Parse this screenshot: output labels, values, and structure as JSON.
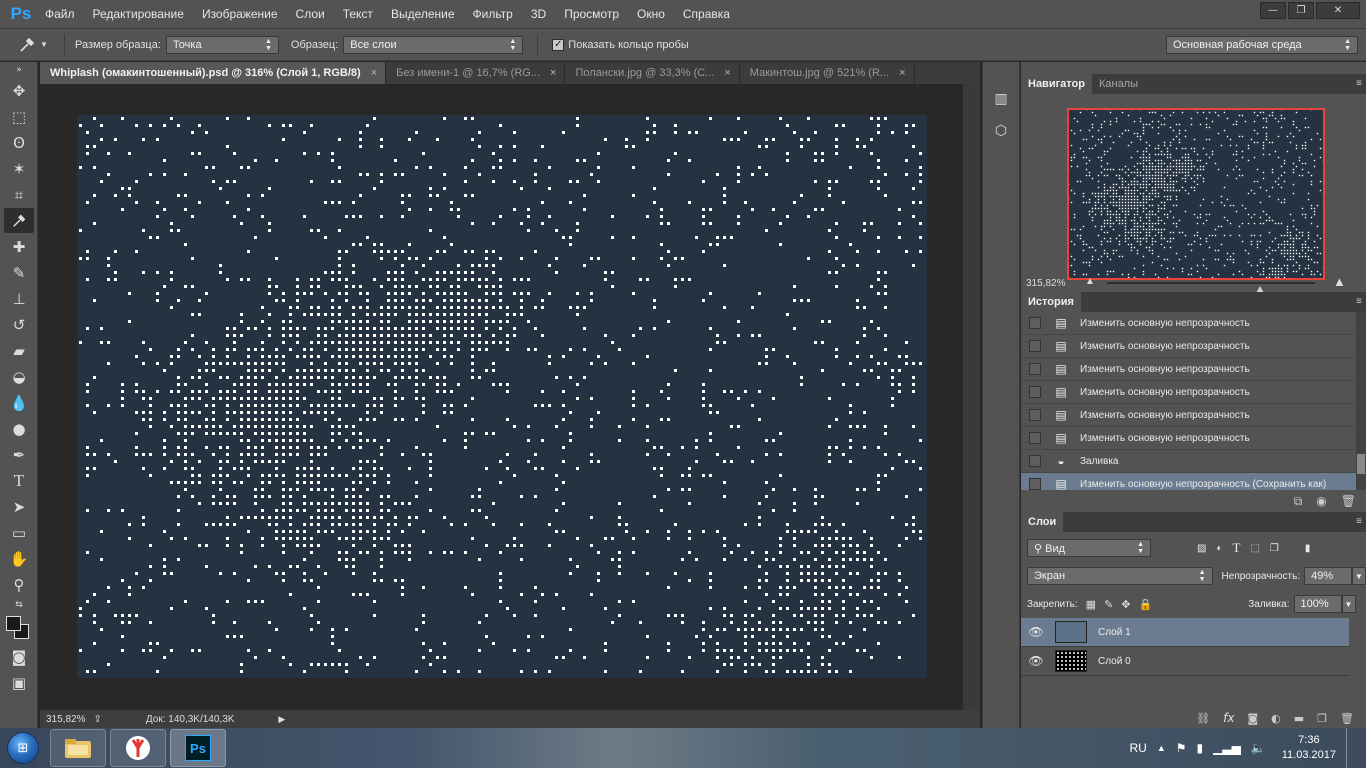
{
  "app": {
    "logo": "Ps"
  },
  "menu": [
    "Файл",
    "Редактирование",
    "Изображение",
    "Слои",
    "Текст",
    "Выделение",
    "Фильтр",
    "3D",
    "Просмотр",
    "Окно",
    "Справка"
  ],
  "window_controls": {
    "minimize": "—",
    "restore": "❐",
    "close": "✕"
  },
  "options": {
    "sample_size_label": "Размер образца:",
    "sample_size_value": "Точка",
    "sample_label": "Образец:",
    "sample_value": "Все слои",
    "show_ring_label": "Показать кольцо пробы",
    "show_ring_checked": true,
    "workspace": "Основная рабочая среда"
  },
  "tabs": [
    {
      "label": "Whiplash (омакинтошенный).psd @ 316% (Слой 1, RGB/8)",
      "active": true
    },
    {
      "label": "Без имени-1 @ 16,7% (RG...",
      "active": false
    },
    {
      "label": "Полански.jpg @ 33,3% (С...",
      "active": false
    },
    {
      "label": "Макинтош.jpg @ 521% (R...",
      "active": false
    }
  ],
  "status": {
    "zoom": "315,82%",
    "doc": "Док: 140,3K/140,3K"
  },
  "navigator": {
    "tab_active": "Навигатор",
    "tab_other": "Каналы",
    "zoom": "315,82%",
    "zoom_slider": 0.73
  },
  "history": {
    "title": "История",
    "items": [
      {
        "label": "Изменить основную непрозрачность",
        "icon": "doc"
      },
      {
        "label": "Изменить основную непрозрачность",
        "icon": "doc"
      },
      {
        "label": "Изменить основную непрозрачность",
        "icon": "doc"
      },
      {
        "label": "Изменить основную непрозрачность",
        "icon": "doc"
      },
      {
        "label": "Изменить основную непрозрачность",
        "icon": "doc"
      },
      {
        "label": "Изменить основную непрозрачность",
        "icon": "doc"
      },
      {
        "label": "Заливка",
        "icon": "bucket"
      },
      {
        "label": "Изменить основную непрозрачность (Сохранить как)",
        "icon": "doc",
        "selected": true
      }
    ]
  },
  "layers": {
    "title": "Слои",
    "filter_kind": "Вид",
    "blend_mode": "Экран",
    "opacity_label": "Непрозрачность:",
    "opacity_value": "49%",
    "lock_label": "Закрепить:",
    "fill_label": "Заливка:",
    "fill_value": "100%",
    "items": [
      {
        "name": "Слой 1",
        "selected": true,
        "thumb_color": "#5a7189"
      },
      {
        "name": "Слой 0",
        "selected": false,
        "thumb_color": "#000000"
      }
    ]
  },
  "taskbar": {
    "lang": "RU",
    "time": "7:36",
    "date": "11.03.2017",
    "ps_label": "Ps"
  },
  "colors": {
    "canvas_bg": "#253242",
    "accent": "#31a8ff",
    "selection": "#6c7c90",
    "nav_frame": "#e8443c"
  }
}
